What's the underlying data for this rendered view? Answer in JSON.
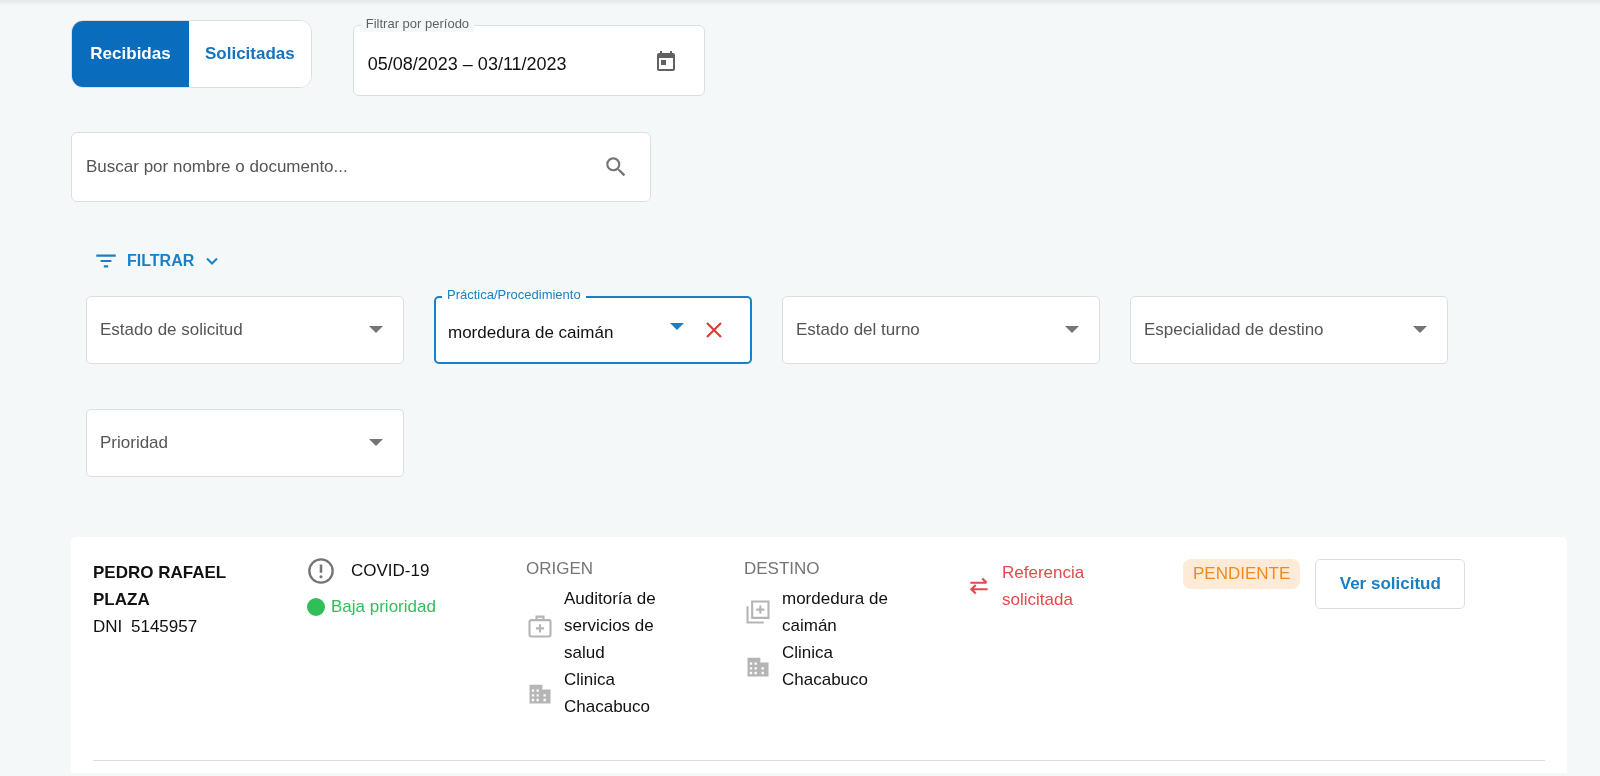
{
  "tabs": [
    {
      "label": "Recibidas",
      "selected": true
    },
    {
      "label": "Solicitadas",
      "selected": false
    }
  ],
  "period_field": {
    "label": "Filtrar por período",
    "value": "05/08/2023 – 03/11/2023"
  },
  "search": {
    "placeholder": "Buscar por nombre o documento..."
  },
  "filter_toggle": {
    "label": "FILTRAR"
  },
  "filters": [
    {
      "label": "Estado de solicitud"
    },
    {
      "label": "Práctica/Procedimiento",
      "value": "mordedura de caimán"
    },
    {
      "label": "Estado del turno"
    },
    {
      "label": "Especialidad de destino"
    },
    {
      "label": "Prioridad"
    }
  ],
  "requests": [
    {
      "name": "PEDRO RAFAEL PLAZA",
      "document": "DNI 5145957",
      "problem": "COVID-19",
      "priority": {
        "label": "Baja prioridad",
        "color": "#2fbf5a"
      },
      "origin": {
        "heading": "ORIGEN",
        "items": [
          {
            "kind": "service",
            "text": "Auditoría de servicios de salud"
          },
          {
            "kind": "institution",
            "text": "Clinica Chacabuco"
          }
        ]
      },
      "destination": {
        "heading": "DESTINO",
        "items": [
          {
            "kind": "practice",
            "text": "mordedura de caimán"
          },
          {
            "kind": "institution",
            "text": "Clinica Chacabuco"
          }
        ]
      },
      "reference": "Referencia solicitada",
      "status": {
        "label": "PENDIENTE",
        "kind": "pending"
      },
      "action": "Ver solicitud"
    }
  ]
}
